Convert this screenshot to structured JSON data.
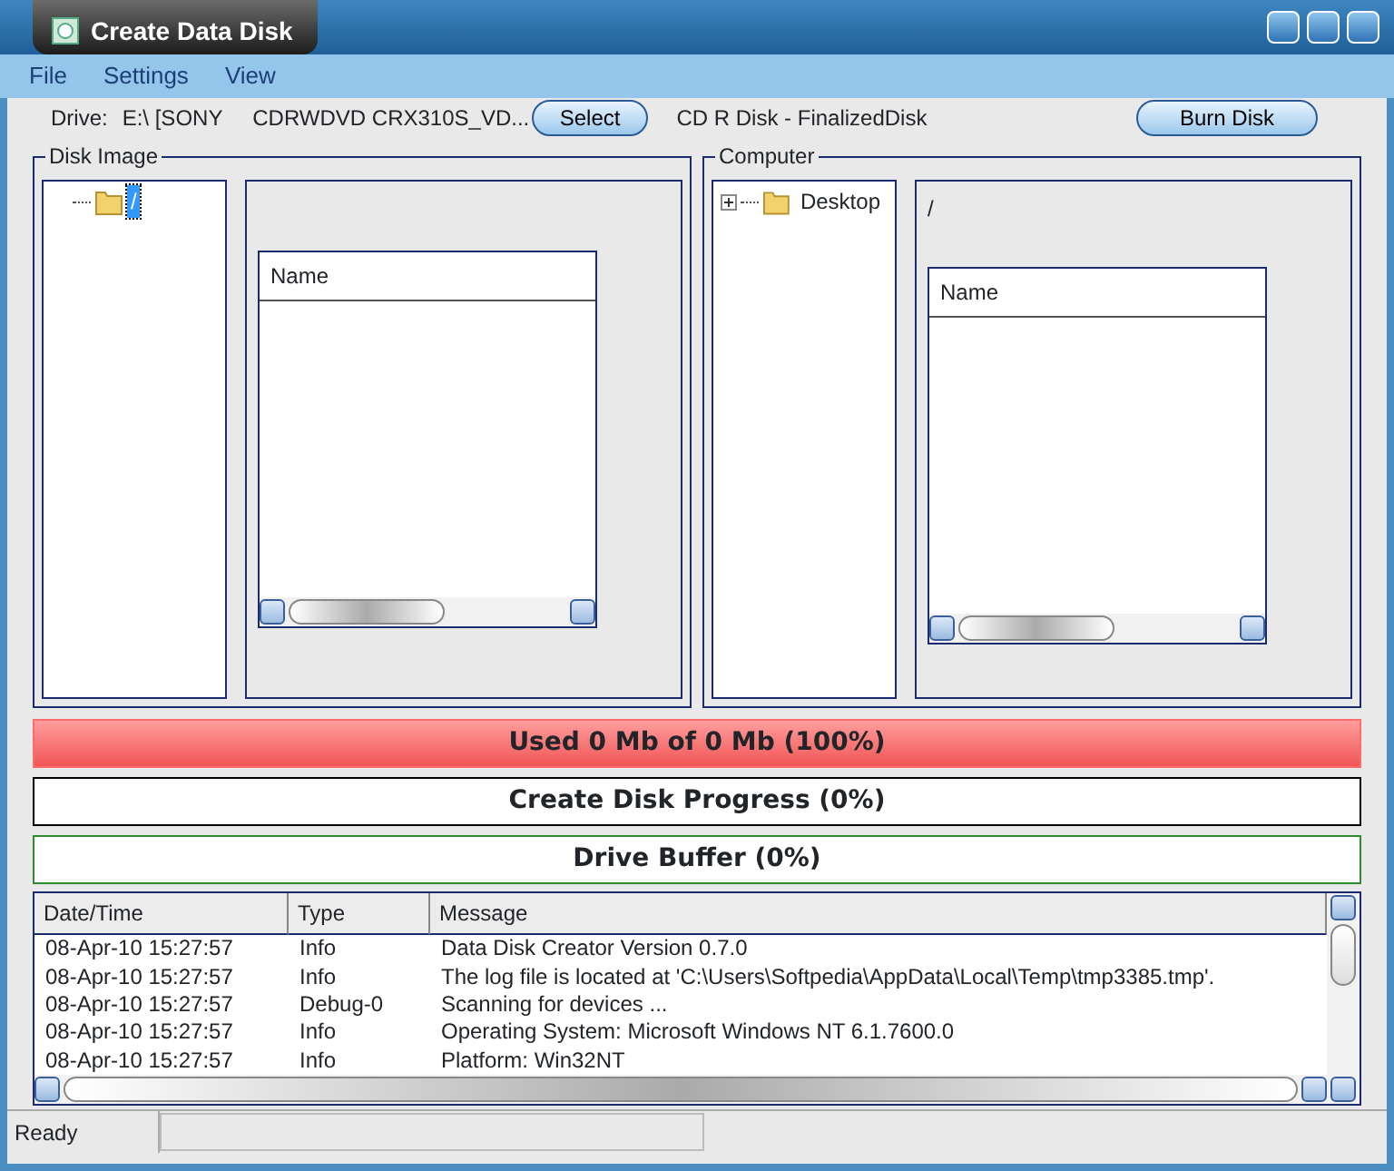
{
  "window": {
    "title": "Create Data Disk"
  },
  "menu": [
    "File",
    "Settings",
    "View"
  ],
  "drive": {
    "label": "Drive:",
    "value": "E:\\ [SONY     CDRWDVD CRX310S_VD...",
    "select_button": "Select",
    "disk_status": "CD R Disk - FinalizedDisk",
    "burn_button": "Burn Disk"
  },
  "panels": [
    {
      "title": "Disk Image",
      "tree": [
        {
          "label": "/",
          "selected": true
        }
      ],
      "list_header": "Name"
    },
    {
      "title": "Computer",
      "tree": [
        {
          "label": "Desktop",
          "selected": false,
          "expanded": false
        }
      ],
      "path": "/",
      "list_header": "Name"
    }
  ],
  "bars": [
    {
      "label": "Used 0 Mb of 0 Mb (100%)",
      "level": 1,
      "color": "#ff6b6b"
    },
    {
      "label": "Create Disk Progress (0%)",
      "color": "#000000"
    },
    {
      "label": "Drive Buffer (0%)",
      "color": "#2e8b2e"
    }
  ],
  "log": {
    "columns": [
      "Date/Time",
      "Type",
      "Message"
    ],
    "rows": [
      [
        "08-Apr-10 15:27:57",
        "Info",
        "Data Disk Creator Version 0.7.0"
      ],
      [
        "08-Apr-10 15:27:57",
        "Info",
        "The log file is located at 'C:\\Users\\Softpedia\\AppData\\Local\\Temp\\tmp3385.tmp'."
      ],
      [
        "08-Apr-10 15:27:57",
        "Debug-0",
        "Scanning for devices ..."
      ],
      [
        "08-Apr-10 15:27:57",
        "Info",
        "Operating System: Microsoft Windows NT 6.1.7600.0"
      ],
      [
        "08-Apr-10 15:27:57",
        "Info",
        "Platform: Win32NT"
      ]
    ]
  },
  "status_bar": "Ready"
}
